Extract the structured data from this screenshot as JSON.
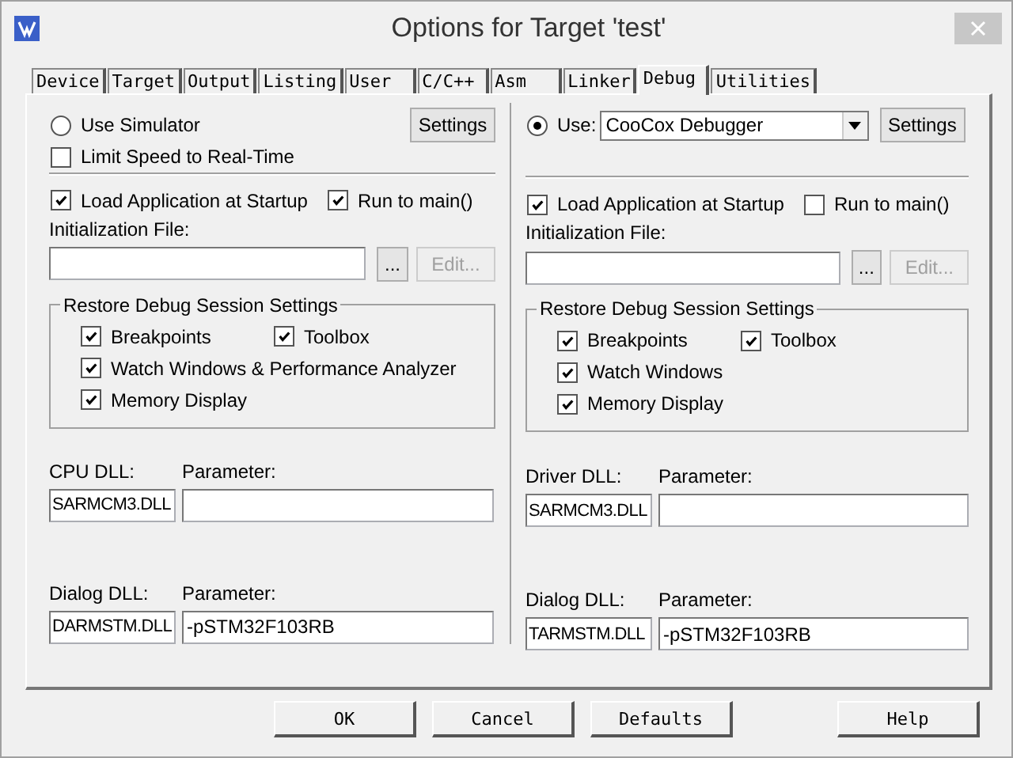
{
  "window": {
    "title": "Options for Target 'test'"
  },
  "tabs": [
    {
      "label": "Device",
      "selected": false
    },
    {
      "label": "Target",
      "selected": false
    },
    {
      "label": "Output",
      "selected": false
    },
    {
      "label": "Listing",
      "selected": false
    },
    {
      "label": "User",
      "selected": false
    },
    {
      "label": "C/C++",
      "selected": false
    },
    {
      "label": "Asm",
      "selected": false
    },
    {
      "label": "Linker",
      "selected": false
    },
    {
      "label": "Debug",
      "selected": true
    },
    {
      "label": "Utilities",
      "selected": false
    }
  ],
  "panes": [
    {
      "kind": "simulator",
      "mode": {
        "label": "Use Simulator",
        "selected": false
      },
      "settings_button": "Settings",
      "limit_speed": {
        "label": "Limit Speed to Real-Time",
        "checked": false
      },
      "load_application": {
        "label": "Load Application at Startup",
        "checked": true
      },
      "run_to_main": {
        "label": "Run to main()",
        "checked": true
      },
      "init_file": {
        "label": "Initialization File:",
        "browse_button": "...",
        "edit_button": {
          "label": "Edit...",
          "disabled": true
        }
      },
      "restore": {
        "title": "Restore Debug Session Settings",
        "options": [
          {
            "label": "Breakpoints",
            "checked": true
          },
          {
            "label": "Toolbox",
            "checked": true
          },
          {
            "label": "Watch Windows & Performance Analyzer",
            "checked": true
          },
          {
            "label": "Memory Display",
            "checked": true
          }
        ]
      },
      "dlls": [
        {
          "label": "CPU DLL:",
          "value": "SARMCM3.DLL",
          "parameter_label": "Parameter:"
        },
        {
          "label": "Dialog DLL:",
          "value": "DARMSTM.DLL",
          "parameter_label": "Parameter:",
          "parameter": "-pSTM32F103RB"
        }
      ]
    },
    {
      "kind": "target",
      "mode": {
        "label": "Use:",
        "selected": true
      },
      "debugger": {
        "value": "CooCox Debugger"
      },
      "settings_button": "Settings",
      "load_application": {
        "label": "Load Application at Startup",
        "checked": true
      },
      "run_to_main": {
        "label": "Run to main()",
        "checked": false
      },
      "init_file": {
        "label": "Initialization File:",
        "browse_button": "...",
        "edit_button": {
          "label": "Edit...",
          "disabled": true
        }
      },
      "restore": {
        "title": "Restore Debug Session Settings",
        "options": [
          {
            "label": "Breakpoints",
            "checked": true
          },
          {
            "label": "Toolbox",
            "checked": true
          },
          {
            "label": "Watch Windows",
            "checked": true
          },
          {
            "label": "Memory Display",
            "checked": true
          }
        ]
      },
      "dlls": [
        {
          "label": "Driver DLL:",
          "value": "SARMCM3.DLL",
          "parameter_label": "Parameter:"
        },
        {
          "label": "Dialog DLL:",
          "value": "TARMSTM.DLL",
          "parameter_label": "Parameter:",
          "parameter": "-pSTM32F103RB"
        }
      ]
    }
  ],
  "buttons": [
    {
      "label": "OK"
    },
    {
      "label": "Cancel"
    },
    {
      "label": "Defaults"
    },
    {
      "label": "Help"
    }
  ]
}
